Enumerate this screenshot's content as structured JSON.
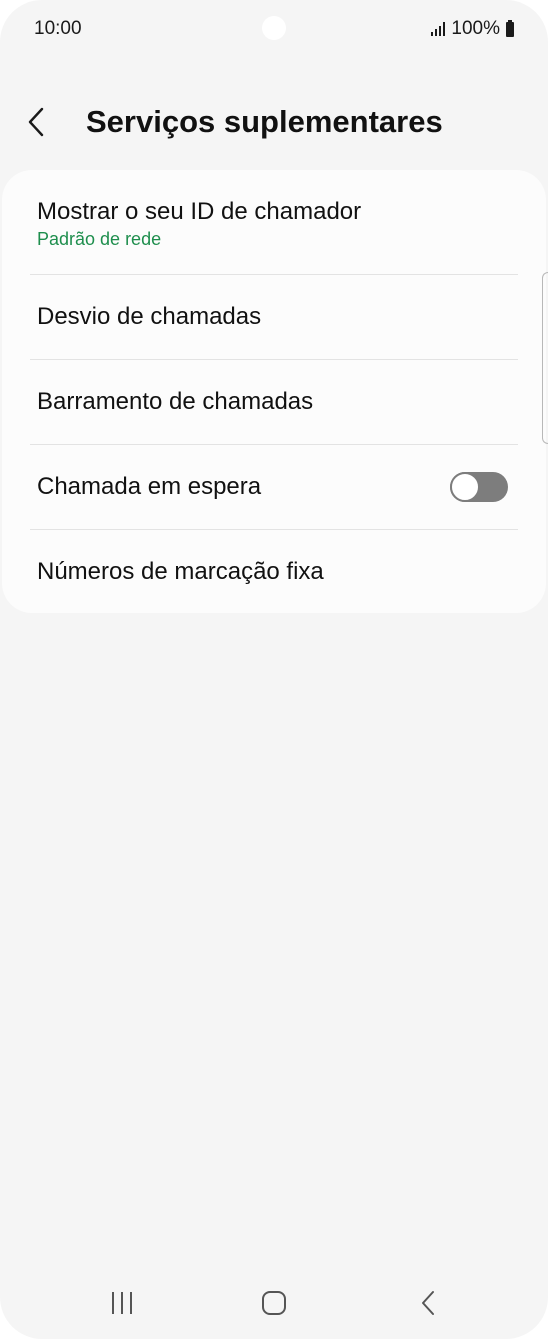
{
  "status_bar": {
    "time": "10:00",
    "battery": "100%",
    "icons": [
      "signal-icon",
      "battery-icon"
    ]
  },
  "header": {
    "back_icon": "chevron-left-icon",
    "title": "Serviços suplementares"
  },
  "settings": {
    "items": [
      {
        "label": "Mostrar o seu ID de chamador",
        "sublabel": "Padrão de rede"
      },
      {
        "label": "Desvio de chamadas"
      },
      {
        "label": "Barramento de chamadas"
      },
      {
        "label": "Chamada em espera",
        "toggle": "off"
      },
      {
        "label": "Números de marcação fixa"
      }
    ],
    "accent_color": "#1e8e4d"
  },
  "nav_bar": {
    "icons": [
      "recent-apps-icon",
      "home-icon",
      "back-icon"
    ]
  }
}
